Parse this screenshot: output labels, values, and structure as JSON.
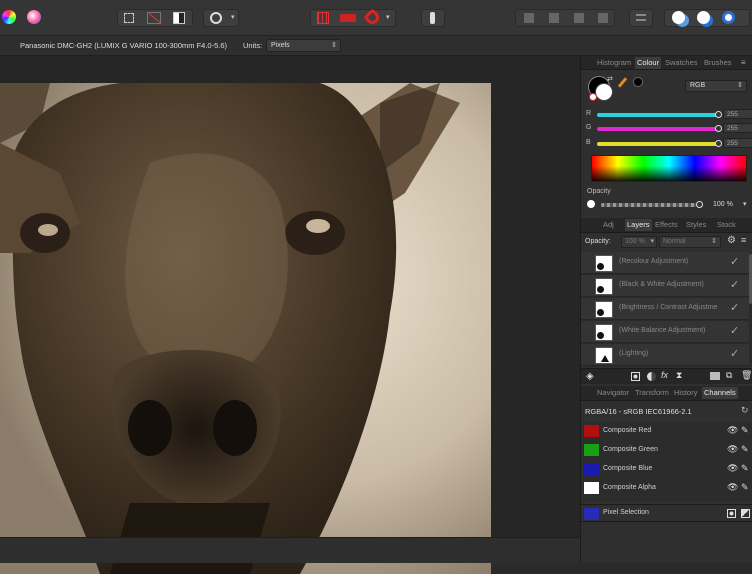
{
  "context_bar": {
    "camera": "Panasonic DMC-GH2 (LUMIX G VARIO 100-300mm F4.0-5.6)",
    "units_label": "Units:",
    "units_value": "Pixels"
  },
  "colour_panel": {
    "tabs": [
      "Histogram",
      "Colour",
      "Swatches",
      "Brushes"
    ],
    "active_tab": "Colour",
    "mode": "RGB",
    "channels": [
      {
        "label": "R",
        "value": "255",
        "color": "#2ad4dc"
      },
      {
        "label": "G",
        "value": "255",
        "color": "#e02ad0"
      },
      {
        "label": "B",
        "value": "255",
        "color": "#e0e02a"
      }
    ],
    "opacity_label": "Opacity",
    "opacity_value": "100 %"
  },
  "layers_panel": {
    "tabs": [
      "Adj",
      "Layers",
      "Effects",
      "Styles",
      "Stock"
    ],
    "active_tab": "Layers",
    "opacity_label": "Opacity:",
    "opacity_value": "100 %",
    "blend_mode": "Normal",
    "layers": [
      {
        "name": "(Recolour Adjustment)",
        "visible": "✓"
      },
      {
        "name": "(Black & White Adjustment)",
        "visible": "✓"
      },
      {
        "name": "(Brightness / Contrast Adjustme",
        "visible": "✓"
      },
      {
        "name": "(White Balance Adjustment)",
        "visible": "✓"
      },
      {
        "name": "(Lighting)",
        "visible": "✓"
      }
    ]
  },
  "channels_panel": {
    "tabs": [
      "Navigator",
      "Transform",
      "History",
      "Channels"
    ],
    "active_tab": "Channels",
    "profile": "RGBA/16 - sRGB IEC61966-2.1",
    "channels": [
      {
        "name": "Composite Red",
        "swatch": "#b01010"
      },
      {
        "name": "Composite Green",
        "swatch": "#18a018"
      },
      {
        "name": "Composite Blue",
        "swatch": "#1a1ab0"
      },
      {
        "name": "Composite Alpha",
        "swatch": "#ffffff"
      }
    ],
    "pixel_selection": "Pixel Selection",
    "pixel_selection_swatch": "#2a2ab8"
  },
  "colors": {
    "accent": "#3c7dd9",
    "panel_bg": "#2f2f2f",
    "toolbar_bg": "#353535"
  }
}
